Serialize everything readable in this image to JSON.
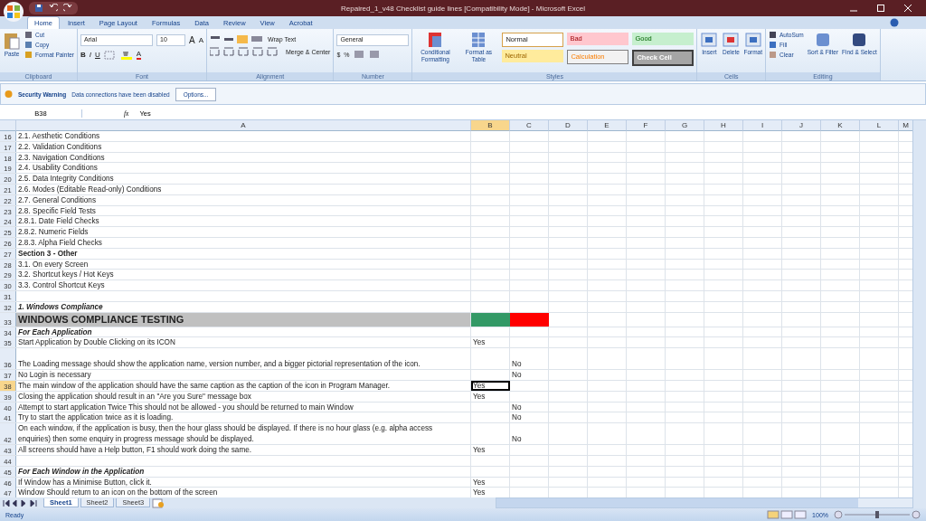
{
  "window": {
    "title": "Repaired_1_v48 Checklist guide lines [Compatibility Mode] - Microsoft Excel"
  },
  "ribbon_tabs": [
    {
      "label": "Home",
      "selected": true
    },
    {
      "label": "Insert",
      "selected": false
    },
    {
      "label": "Page Layout",
      "selected": false
    },
    {
      "label": "Formulas",
      "selected": false
    },
    {
      "label": "Data",
      "selected": false
    },
    {
      "label": "Review",
      "selected": false
    },
    {
      "label": "View",
      "selected": false
    },
    {
      "label": "Acrobat",
      "selected": false
    }
  ],
  "clipboard": {
    "label": "Clipboard",
    "paste": "Paste",
    "items": [
      "Cut",
      "Copy",
      "Format Painter"
    ]
  },
  "font": {
    "label": "Font",
    "font_name": "Arial",
    "font_size": "10",
    "size_buttons": [
      "A",
      "A"
    ],
    "format_buttons": [
      "B",
      "I",
      "U"
    ],
    "font_color": "A"
  },
  "alignment": {
    "label": "Alignment",
    "wrap": "Wrap Text",
    "merge": "Merge & Center"
  },
  "number": {
    "label": "Number",
    "format": "General",
    "currency": "$",
    "percent": "%"
  },
  "styles": {
    "label": "Styles",
    "conditional": "Conditional Formatting",
    "format_table": "Format as Table",
    "cell_styles": [
      {
        "label": "Normal",
        "kind": "normal"
      },
      {
        "label": "Bad",
        "kind": "bad"
      },
      {
        "label": "Good",
        "kind": "good"
      },
      {
        "label": "Neutral",
        "kind": "neutral"
      },
      {
        "label": "Calculation",
        "kind": "calculation"
      },
      {
        "label": "Check Cell",
        "kind": "check"
      }
    ]
  },
  "cells": {
    "label": "Cells",
    "buttons": [
      "Insert",
      "Delete",
      "Format"
    ]
  },
  "editing": {
    "label": "Editing",
    "items": [
      "AutoSum",
      "Fill",
      "Clear"
    ],
    "buttons": [
      "Sort & Filter",
      "Find & Select"
    ]
  },
  "security_bar": {
    "title": "Security Warning",
    "message": "Data connections have been disabled",
    "button": "Options..."
  },
  "formula_bar": {
    "name_box": "B38",
    "function_label": "fx",
    "value": "Yes"
  },
  "columns": [
    {
      "label": "A",
      "selected": false
    },
    {
      "label": "B",
      "selected": true
    },
    {
      "label": "C",
      "selected": false
    },
    {
      "label": "D",
      "selected": false
    },
    {
      "label": "E",
      "selected": false
    },
    {
      "label": "F",
      "selected": false
    },
    {
      "label": "G",
      "selected": false
    },
    {
      "label": "H",
      "selected": false
    },
    {
      "label": "I",
      "selected": false
    },
    {
      "label": "J",
      "selected": false
    },
    {
      "label": "K",
      "selected": false
    },
    {
      "label": "L",
      "selected": false
    },
    {
      "label": "M",
      "selected": false
    }
  ],
  "rows": [
    {
      "num": "16",
      "a": "2.1. Aesthetic Conditions",
      "kind": "normal",
      "selected": false
    },
    {
      "num": "17",
      "a": "2.2. Validation Conditions",
      "kind": "normal",
      "selected": false
    },
    {
      "num": "18",
      "a": "2.3. Navigation Conditions",
      "kind": "normal",
      "selected": false
    },
    {
      "num": "19",
      "a": "2.4. Usability Conditions",
      "kind": "normal",
      "selected": false
    },
    {
      "num": "20",
      "a": "2.5. Data Integrity Conditions",
      "kind": "normal",
      "selected": false
    },
    {
      "num": "21",
      "a": "2.6. Modes (Editable Read-only) Conditions",
      "kind": "normal",
      "selected": false
    },
    {
      "num": "22",
      "a": "2.7. General Conditions",
      "kind": "normal",
      "selected": false
    },
    {
      "num": "23",
      "a": "2.8. Specific Field Tests",
      "kind": "normal",
      "selected": false
    },
    {
      "num": "24",
      "a": "2.8.1. Date Field Checks",
      "kind": "normal",
      "selected": false
    },
    {
      "num": "25",
      "a": "2.8.2. Numeric Fields",
      "kind": "normal",
      "selected": false
    },
    {
      "num": "26",
      "a": "2.8.3. Alpha Field Checks",
      "kind": "normal",
      "selected": false
    },
    {
      "num": "27",
      "a": "Section 3 - Other",
      "kind": "bold",
      "selected": false
    },
    {
      "num": "28",
      "a": "3.1. On every Screen",
      "kind": "normal",
      "selected": false
    },
    {
      "num": "29",
      "a": "3.2. Shortcut keys / Hot Keys",
      "kind": "normal",
      "selected": false
    },
    {
      "num": "30",
      "a": "3.3. Control Shortcut Keys",
      "kind": "normal",
      "selected": false
    },
    {
      "num": "31",
      "kind": "normal",
      "selected": false
    },
    {
      "num": "32",
      "a": "1. Windows Compliance",
      "kind": "bold-italic",
      "selected": false
    },
    {
      "num": "33",
      "a": "WINDOWS COMPLIANCE TESTING",
      "kind": "heading",
      "selected": false,
      "b_fill": {
        "color": "#339966"
      },
      "c_fill": {
        "color": "#ff0000"
      }
    },
    {
      "num": "34",
      "a": "For Each Application",
      "kind": "bold-italic",
      "selected": false
    },
    {
      "num": "35",
      "a": "Start Application by Double Clicking on its ICON",
      "kind": "normal",
      "selected": false,
      "b": "Yes"
    },
    {
      "num": "36",
      "a": "The Loading message should show the application name, version number, and a bigger pictorial representation of the icon.",
      "kind": "wrap",
      "selected": false,
      "c": "No"
    },
    {
      "num": "37",
      "a": "No Login is necessary",
      "kind": "normal",
      "selected": false,
      "c": "No"
    },
    {
      "num": "38",
      "a": "The main window of the application should have the same caption as the caption of the icon in Program Manager.",
      "kind": "normal",
      "selected": true,
      "b": "Yes"
    },
    {
      "num": "39",
      "a": "Closing the application should result in an \"Are you Sure\" message box",
      "kind": "normal",
      "selected": false,
      "b": "Yes"
    },
    {
      "num": "40",
      "a": "Attempt to start application Twice This should not be allowed - you should be returned to main Window",
      "kind": "normal",
      "selected": false,
      "c": "No"
    },
    {
      "num": "41",
      "a": "Try to start the application twice as it is loading.",
      "kind": "normal",
      "selected": false,
      "c": "No"
    },
    {
      "num": "42",
      "a": "On each window, if the application is busy, then the hour glass should be displayed. If there is no hour glass (e.g. alpha access enquiries) then some enquiry in progress message should be displayed.",
      "kind": "wrap",
      "selected": false,
      "c": "No"
    },
    {
      "num": "43",
      "a": "All screens should have a Help button, F1 should work doing the same.",
      "kind": "normal",
      "selected": false,
      "b": "Yes"
    },
    {
      "num": "44",
      "kind": "normal",
      "selected": false
    },
    {
      "num": "45",
      "a": "For Each Window in the Application",
      "kind": "bold-italic",
      "selected": false
    },
    {
      "num": "46",
      "a": "If Window has a Minimise Button, click it.",
      "kind": "normal",
      "selected": false,
      "b": "Yes"
    },
    {
      "num": "47",
      "a": "Window Should return to an icon on the bottom of the screen",
      "kind": "normal",
      "selected": false,
      "b": "Yes"
    }
  ],
  "sheet_tabs": [
    {
      "label": "Sheet1",
      "selected": true
    },
    {
      "label": "Sheet2",
      "selected": false
    },
    {
      "label": "Sheet3",
      "selected": false
    }
  ],
  "status_bar": {
    "status": "Ready",
    "zoom": "100%",
    "zoom_slider": {
      "level": 0.5
    }
  }
}
